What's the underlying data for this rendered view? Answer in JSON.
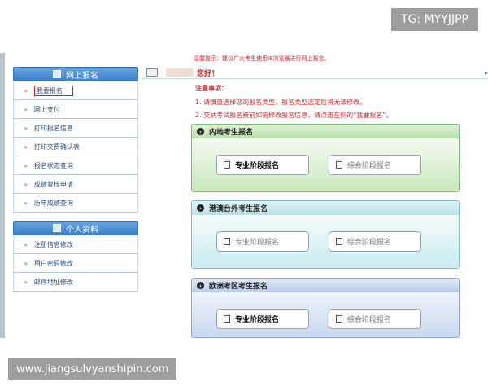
{
  "watermarks": {
    "top": "TG: MYYJJPP",
    "bottom": "www.jiangsulvyanshipin.com"
  },
  "header": {
    "tip": "温馨提示：建议广大考生使用IE浏览器进行网上报名。",
    "greeting": "您好！"
  },
  "sidebar": {
    "panel1": {
      "title": "网上报名",
      "items": [
        {
          "label": "我要报名"
        },
        {
          "label": "网上支付"
        },
        {
          "label": "打印报名信息"
        },
        {
          "label": "打印交费确认表"
        },
        {
          "label": "报名状态查询"
        },
        {
          "label": "成绩复核申请"
        },
        {
          "label": "历年成绩查询"
        }
      ]
    },
    "panel2": {
      "title": "个人资料",
      "items": [
        {
          "label": "注册信息修改"
        },
        {
          "label": "用户密码修改"
        },
        {
          "label": "邮件地址修改"
        }
      ]
    },
    "bullet": "»"
  },
  "notice": {
    "title": "注意事项：",
    "line1": "1. 请慎重选择您的报名类型，报名类型选定后将无法修改。",
    "line2": "2. 交纳考试报名费前如需修改报名信息，请点击左侧的“我要报名”。"
  },
  "sections": [
    {
      "title": "内地考生报名",
      "btn1": "专业阶段报名",
      "btn2": "综合阶段报名"
    },
    {
      "title": "港澳台外考生报名",
      "btn1": "专业阶段报名",
      "btn2": "综合阶段报名"
    },
    {
      "title": "欧洲考区考生报名",
      "btn1": "专业阶段报名",
      "btn2": "综合阶段报名"
    }
  ],
  "icons": {
    "section_marker": "circle-arrow-icon",
    "button_icon": "document-icon"
  }
}
